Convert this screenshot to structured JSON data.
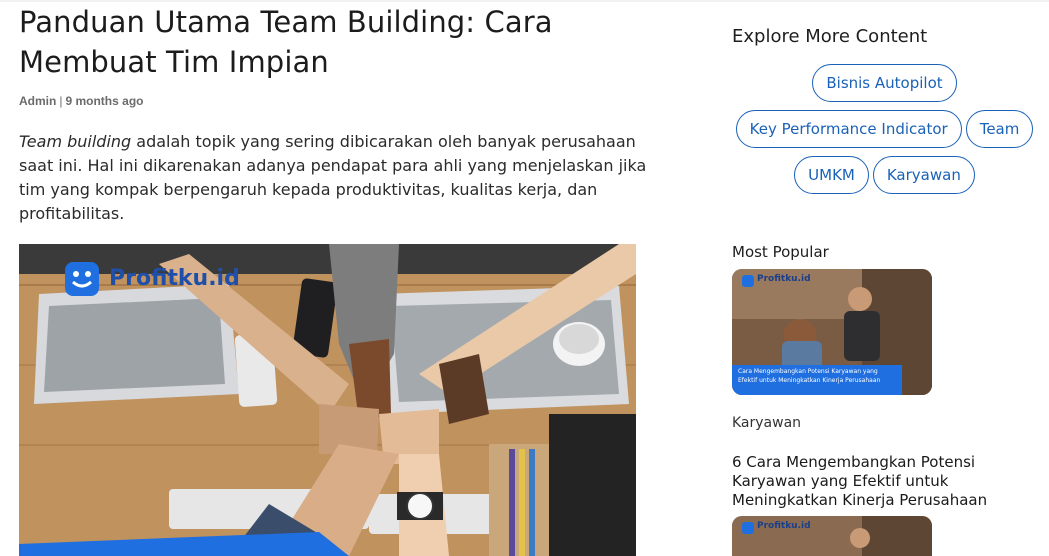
{
  "article": {
    "title": "Panduan Utama Team Building: Cara Membuat Tim Impian",
    "author": "Admin",
    "separator": "|",
    "time_ago": "9 months ago",
    "intro_em": "Team building",
    "intro_rest": " adalah topik yang sering dibicarakan oleh banyak perusahaan saat ini. Hal ini dikarenakan adanya pendapat para ahli yang menjelaskan jika tim yang kompak berpengaruh kepada produktivitas, kualitas kerja, dan profitabilitas.",
    "hero_logo": "Profitku.id"
  },
  "sidebar": {
    "explore_heading": "Explore More Content",
    "tags": [
      [
        "Bisnis Autopilot"
      ],
      [
        "Key Performance Indicator",
        "Team"
      ],
      [
        "UMKM",
        "Karyawan"
      ]
    ],
    "popular_heading": "Most Popular",
    "popular": [
      {
        "logo": "Profitku.id",
        "banner_line1": "Cara Mengembangkan Potensi Karyawan yang",
        "banner_line2": "Efektif untuk Meningkatkan Kinerja Perusahaan",
        "category": "Karyawan",
        "title": "6 Cara Mengembangkan Potensi Karyawan yang Efektif untuk Meningkatkan Kinerja Perusahaan"
      },
      {
        "logo": "Profitku.id"
      }
    ]
  },
  "colors": {
    "tag_blue": "#1a62b8",
    "brand_blue": "#1f6fe0"
  }
}
